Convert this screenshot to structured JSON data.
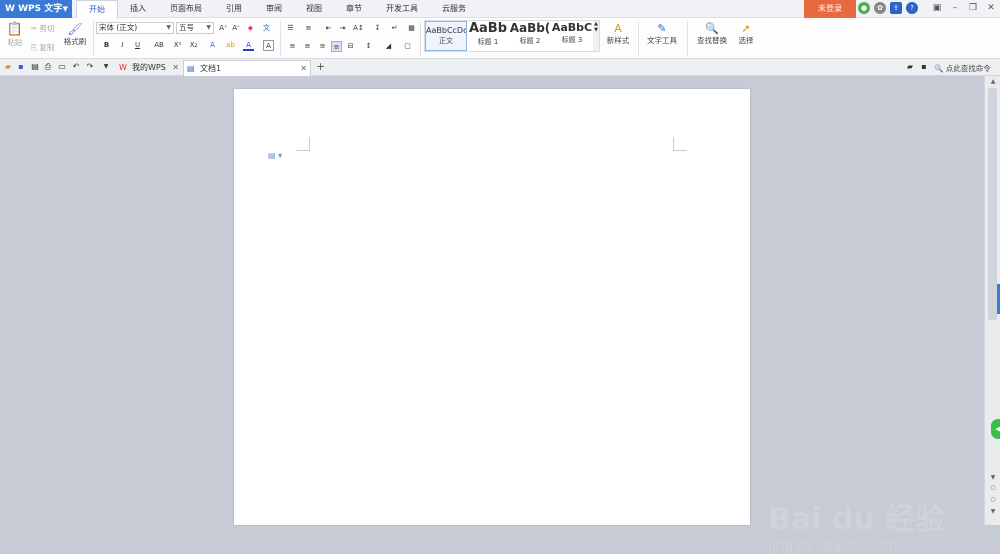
{
  "app": {
    "name": "WPS 文字"
  },
  "menu_tabs": [
    "开始",
    "插入",
    "页面布局",
    "引用",
    "审阅",
    "视图",
    "章节",
    "开发工具",
    "云服务"
  ],
  "active_tab": "开始",
  "login_label": "未登录",
  "ribbon": {
    "paste": "粘贴",
    "cut": "剪切",
    "copy": "复制",
    "format_painter": "格式刷",
    "font_name": "宋体 (正文)",
    "font_size": "五号",
    "styles": [
      {
        "preview": "AaBbCcDd",
        "name": "正文"
      },
      {
        "preview": "AaBb",
        "name": "标题 1"
      },
      {
        "preview": "AaBb(",
        "name": "标题 2"
      },
      {
        "preview": "AaBbC",
        "name": "标题 3"
      }
    ],
    "new_style": "新样式",
    "text_tools": "文字工具",
    "find_replace": "查找替换",
    "select": "选择",
    "bold": "B",
    "italic": "I",
    "underline": "U",
    "superscript": "X²",
    "subscript": "X₂"
  },
  "doc_tabs": [
    {
      "label": "我的WPS"
    },
    {
      "label": "文档1"
    }
  ],
  "search_command": "点此查找命令",
  "watermark": {
    "brand": "Bai du 经验",
    "url": "jingyan.baidu.com"
  },
  "colors": {
    "accent": "#3a7ad6",
    "login": "#e8693e",
    "font_color": "#1f3fbf"
  }
}
